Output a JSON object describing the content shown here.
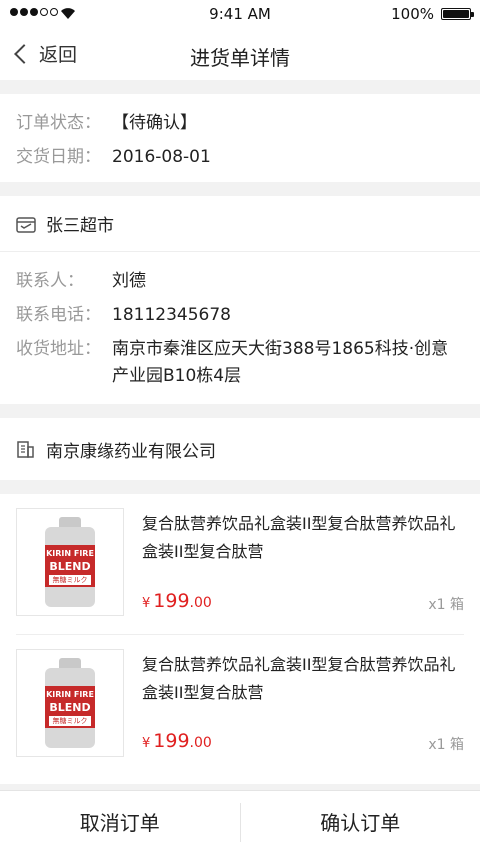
{
  "status_bar": {
    "time": "9:41 AM",
    "battery_pct": "100%",
    "signal_icon": "signal-dots-icon",
    "wifi_icon": "wifi-icon",
    "battery_icon": "battery-icon"
  },
  "navbar": {
    "back_label": "返回",
    "title": "进货单详情"
  },
  "order": {
    "status_label": "订单状态：",
    "status_value": "【待确认】",
    "date_label": "交货日期：",
    "date_value": "2016-08-01"
  },
  "shop": {
    "icon": "store-icon",
    "name": "张三超市",
    "contact_label": "联系人：",
    "contact_value": "刘德",
    "phone_label": "联系电话：",
    "phone_value": "18112345678",
    "address_label": "收货地址：",
    "address_value": "南京市秦淮区应天大街388号1865科技·创意产业园B10栋4层"
  },
  "supplier": {
    "icon": "building-icon",
    "name": "南京康缘药业有限公司"
  },
  "goods": [
    {
      "name": "复合肽营养饮品礼盒装II型复合肽营养饮品礼盒装II型复合肽营",
      "price_symbol": "¥",
      "price_int": "199",
      "price_dec": ".00",
      "qty": "x1 箱",
      "image_text": [
        "KIRIN FIRE",
        "BLEND",
        "無糖ミルク"
      ]
    },
    {
      "name": "复合肽营养饮品礼盒装II型复合肽营养饮品礼盒装II型复合肽营",
      "price_symbol": "¥",
      "price_int": "199",
      "price_dec": ".00",
      "qty": "x1 箱",
      "image_text": [
        "KIRIN FIRE",
        "BLEND",
        "無糖ミルク"
      ]
    }
  ],
  "actions": {
    "cancel_label": "取消订单",
    "confirm_label": "确认订单"
  },
  "colors": {
    "price": "#e02020",
    "label": "#999999",
    "background": "#f2f2f2"
  }
}
